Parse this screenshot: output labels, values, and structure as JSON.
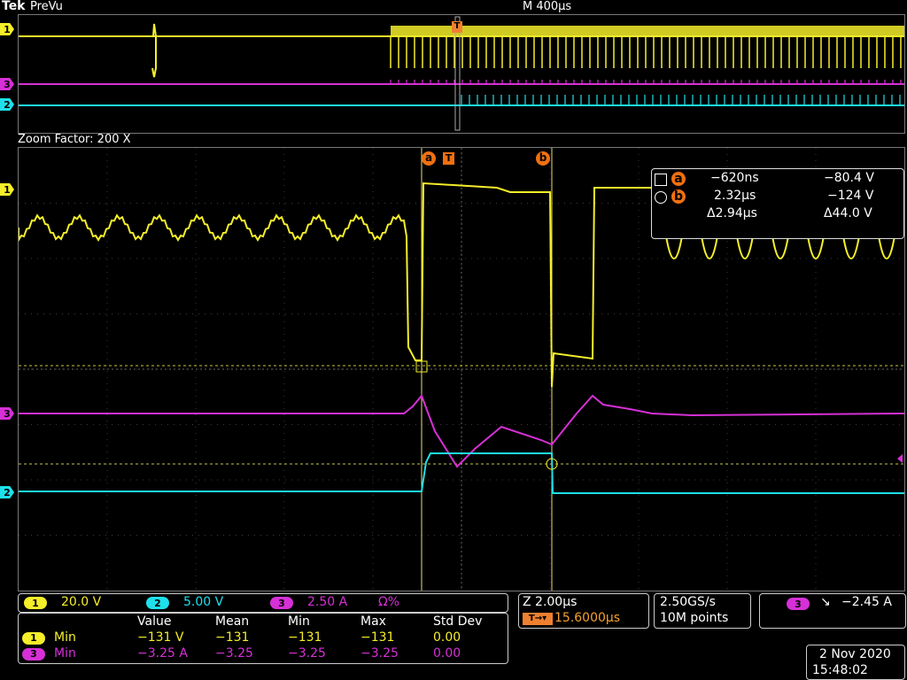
{
  "header": {
    "brand": "Tek",
    "mode": "PreVu",
    "timebase": "M 400µs"
  },
  "zoom": {
    "label": "Zoom Factor: 200 X"
  },
  "markers": {
    "trigger": "T",
    "cursor_a": "a",
    "cursor_b": "b"
  },
  "channels": {
    "ch1": {
      "num": "1",
      "color": "#f5ee2a",
      "scale": "20.0 V"
    },
    "ch2": {
      "num": "2",
      "color": "#1ee0ea",
      "scale": "5.00 V"
    },
    "ch3": {
      "num": "3",
      "color": "#d630d6",
      "scale": "2.50 A",
      "extra": "Ω%"
    }
  },
  "cursors": {
    "a": {
      "time": "−620ns",
      "value": "−80.4 V"
    },
    "b": {
      "time": "2.32µs",
      "value": "−124 V"
    },
    "delta": {
      "time": "Δ2.94µs",
      "value": "Δ44.0 V"
    }
  },
  "horizontal": {
    "scale": "Z 2.00µs",
    "delay": "15.6000µs"
  },
  "acquisition": {
    "rate": "2.50GS/s",
    "points": "10M points"
  },
  "trigger": {
    "channel": "3",
    "slope": "↘",
    "level": "−2.45 A"
  },
  "measurements": {
    "headers": [
      "Value",
      "Mean",
      "Min",
      "Max",
      "Std Dev"
    ],
    "rows": [
      {
        "ch": "1",
        "name": "Min",
        "value": "−131 V",
        "mean": "−131",
        "min": "−131",
        "max": "−131",
        "std": "0.00"
      },
      {
        "ch": "3",
        "name": "Min",
        "value": "−3.25 A",
        "mean": "−3.25",
        "min": "−3.25",
        "max": "−3.25",
        "std": "0.00"
      }
    ]
  },
  "datetime": {
    "date": "2 Nov 2020",
    "time": "15:48:02"
  }
}
